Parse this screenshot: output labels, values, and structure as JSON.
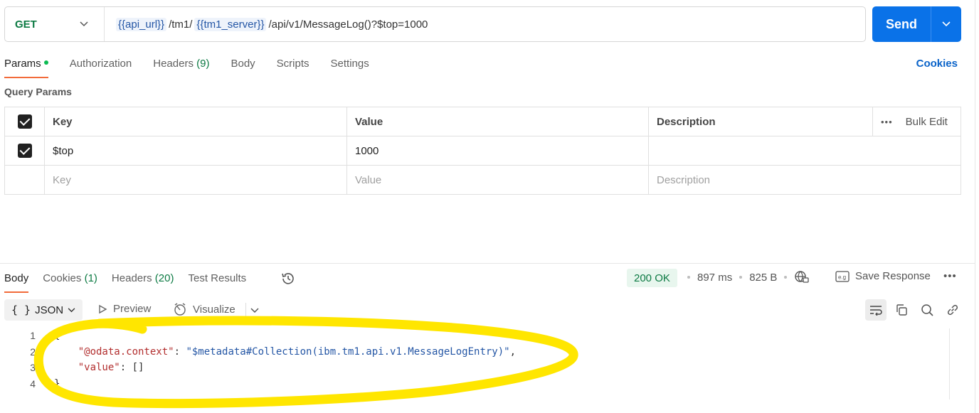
{
  "request": {
    "method": "GET",
    "url_parts": [
      {
        "type": "var",
        "text": "{{api_url}}"
      },
      {
        "type": "plain",
        "text": "/tm1/"
      },
      {
        "type": "var",
        "text": "{{tm1_server}}"
      },
      {
        "type": "plain",
        "text": "/api/v1/MessageLog()?$top=1000"
      }
    ],
    "send_label": "Send"
  },
  "request_tabs": {
    "params": "Params",
    "authorization": "Authorization",
    "headers": "Headers",
    "headers_count": "(9)",
    "body": "Body",
    "scripts": "Scripts",
    "settings": "Settings",
    "cookies": "Cookies"
  },
  "query_params": {
    "title": "Query Params",
    "headers": {
      "key": "Key",
      "value": "Value",
      "description": "Description",
      "bulk_edit": "Bulk Edit"
    },
    "rows": [
      {
        "key": "$top",
        "value": "1000",
        "description": ""
      }
    ],
    "placeholders": {
      "key": "Key",
      "value": "Value",
      "description": "Description"
    }
  },
  "response_tabs": {
    "body": "Body",
    "cookies": "Cookies",
    "cookies_count": "(1)",
    "headers": "Headers",
    "headers_count": "(20)",
    "test_results": "Test Results"
  },
  "response_meta": {
    "status": "200 OK",
    "time": "897 ms",
    "size": "825 B",
    "save_response": "Save Response"
  },
  "response_toolbar": {
    "format": "JSON",
    "preview": "Preview",
    "visualize": "Visualize"
  },
  "response_body": {
    "line_numbers": [
      "1",
      "2",
      "3",
      "4"
    ],
    "open_brace": "{",
    "close_brace": "}",
    "context_key": "\"@odata.context\"",
    "context_value": "\"$metadata#Collection(ibm.tm1.api.v1.MessageLogEntry)\"",
    "value_key": "\"value\"",
    "value_value": "[]"
  },
  "colors": {
    "accent": "#0a72e8",
    "method_get": "#0c7a43",
    "tab_underline": "#f26b3a",
    "highlight_marker": "#ffe600"
  }
}
